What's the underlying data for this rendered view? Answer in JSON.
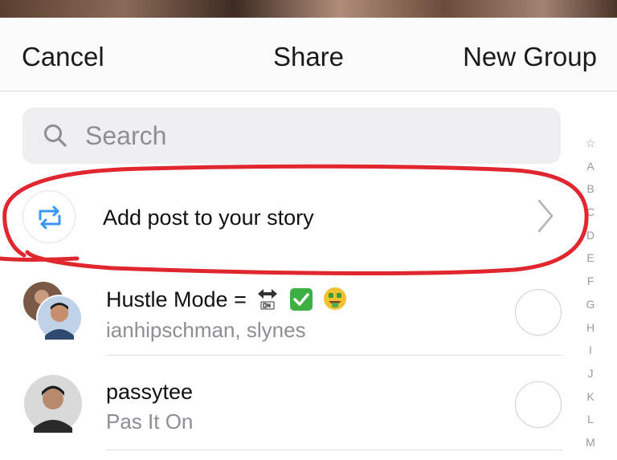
{
  "header": {
    "cancel_label": "Cancel",
    "title": "Share",
    "new_group_label": "New Group"
  },
  "search": {
    "placeholder": "Search",
    "value": ""
  },
  "index_letters": [
    "☆",
    "A",
    "B",
    "C",
    "D",
    "E",
    "F",
    "G",
    "H",
    "I",
    "J",
    "K",
    "L",
    "M"
  ],
  "story_row": {
    "label": "Add post to your story",
    "icon": "repost-arrows-icon",
    "accent_color": "#3897f0"
  },
  "conversations": [
    {
      "name": "Hustle Mode =",
      "emoji_badges": [
        "left-right-arrow-on-icon",
        "green-check-icon",
        "money-mouth-face-icon"
      ],
      "subtitle": "ianhipschman, slynes",
      "avatar": "group-avatar"
    },
    {
      "name": "passytee",
      "subtitle": "Pas It On",
      "avatar": "user-avatar"
    }
  ],
  "annotation_color": "#e0262e"
}
